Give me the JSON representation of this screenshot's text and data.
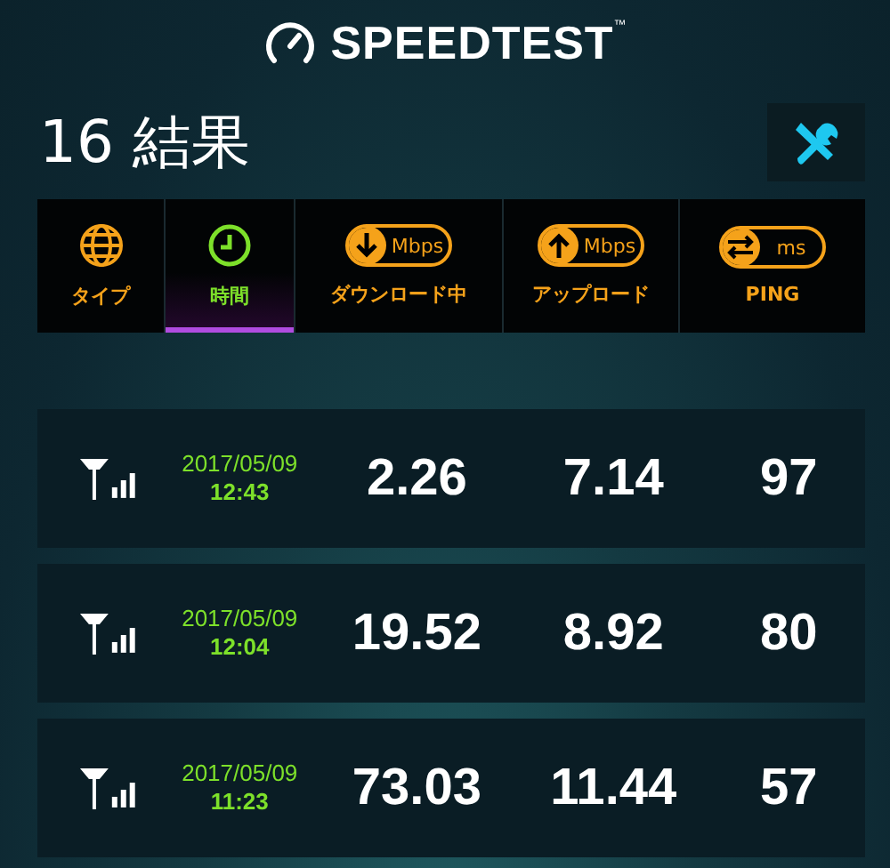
{
  "header": {
    "logo_text": "SPEEDTEST",
    "trademark": "™"
  },
  "title": "16 結果",
  "sort_columns": [
    {
      "kind": "type",
      "label": "タイプ",
      "selected": false
    },
    {
      "kind": "time",
      "label": "時間",
      "selected": true
    },
    {
      "kind": "download",
      "unit": "Mbps",
      "label": "ダウンロード中",
      "selected": false
    },
    {
      "kind": "upload",
      "unit": "Mbps",
      "label": "アップロード",
      "selected": false
    },
    {
      "kind": "ping",
      "unit": "ms",
      "label": "PING",
      "selected": false
    }
  ],
  "results": [
    {
      "date": "2017/05/09",
      "time": "12:43",
      "download": "2.26",
      "upload": "7.14",
      "ping": "97"
    },
    {
      "date": "2017/05/09",
      "time": "12:04",
      "download": "19.52",
      "upload": "8.92",
      "ping": "80"
    },
    {
      "date": "2017/05/09",
      "time": "11:23",
      "download": "73.03",
      "upload": "11.44",
      "ping": "57"
    }
  ]
}
